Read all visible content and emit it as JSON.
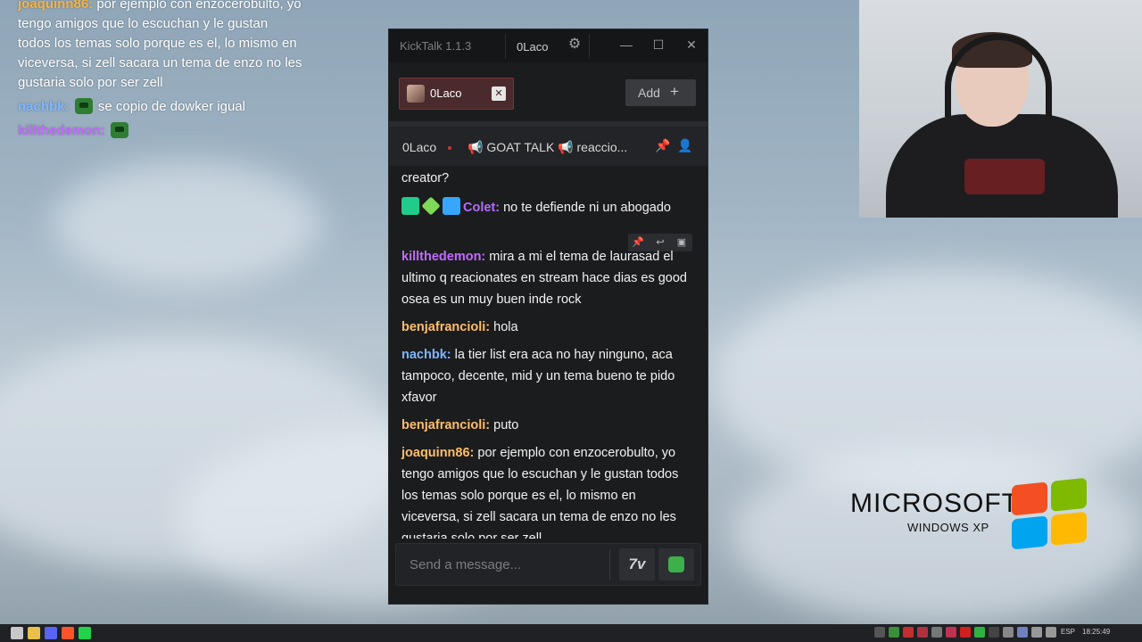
{
  "overlay": {
    "lines": [
      {
        "user": "joaquinn86:",
        "text": "por ejemplo con enzocerobulto, yo tengo amigos que lo escuchan y le gustan todos los temas solo porque es el, lo mismo en viceversa, si zell sacara un tema de enzo no les gustaria solo por ser zell",
        "user_color": "#f5b342"
      },
      {
        "user": "nachbk:",
        "text": "se copio de dowker igual",
        "user_color": "#7fb6ff"
      },
      {
        "user": "killthedemon:",
        "text": "",
        "user_color": "#c46bff"
      }
    ]
  },
  "window": {
    "title": "KickTalk 1.1.3",
    "username": "0Laco",
    "controls": {
      "minimize": "—",
      "maximize": "☐",
      "close": "✕"
    }
  },
  "tabs": [
    {
      "label": "0Laco",
      "close": "✕"
    }
  ],
  "add_button": {
    "label": "Add",
    "icon": "+"
  },
  "channel_header": {
    "name": "0Laco",
    "stream_title": "📢 GOAT TALK 📢 reaccio..."
  },
  "chat": {
    "messages": [
      {
        "user": "",
        "text": "creator?"
      },
      {
        "user": "Colet:",
        "text": " no te defiende ni un abogado",
        "color": "#b36cff"
      },
      {
        "user": "killthedemon:",
        "text": " mira a mi el tema de laurasad el ultimo q reacionates en stream hace dias es good osea es un muy buen inde rock",
        "color": "#c46bff"
      },
      {
        "user": "benjafrancioli:",
        "text": " hola",
        "color": "#ffbe6a"
      },
      {
        "user": "nachbk:",
        "text": " la tier list era aca no hay ninguno, aca tampoco, decente, mid y un tema bueno te pido xfavor",
        "color": "#7fb6ff"
      },
      {
        "user": "benjafrancioli:",
        "text": " puto",
        "color": "#ffbe6a"
      },
      {
        "user": "joaquinn86:",
        "text": " por ejemplo con enzocerobulto, yo tengo amigos que lo escuchan y le gustan todos los temas solo porque es el, lo mismo en viceversa, si zell sacara un tema de enzo no les gustaria solo por ser zell",
        "color": "#ffbe6a"
      }
    ]
  },
  "input": {
    "placeholder": "Send a message...",
    "kt_label": "7v"
  },
  "desktop": {
    "brand": "MICROSOFT",
    "product": "WINDOWS XP"
  },
  "taskbar": {
    "lang": "ESP",
    "time": "18:25:49"
  }
}
